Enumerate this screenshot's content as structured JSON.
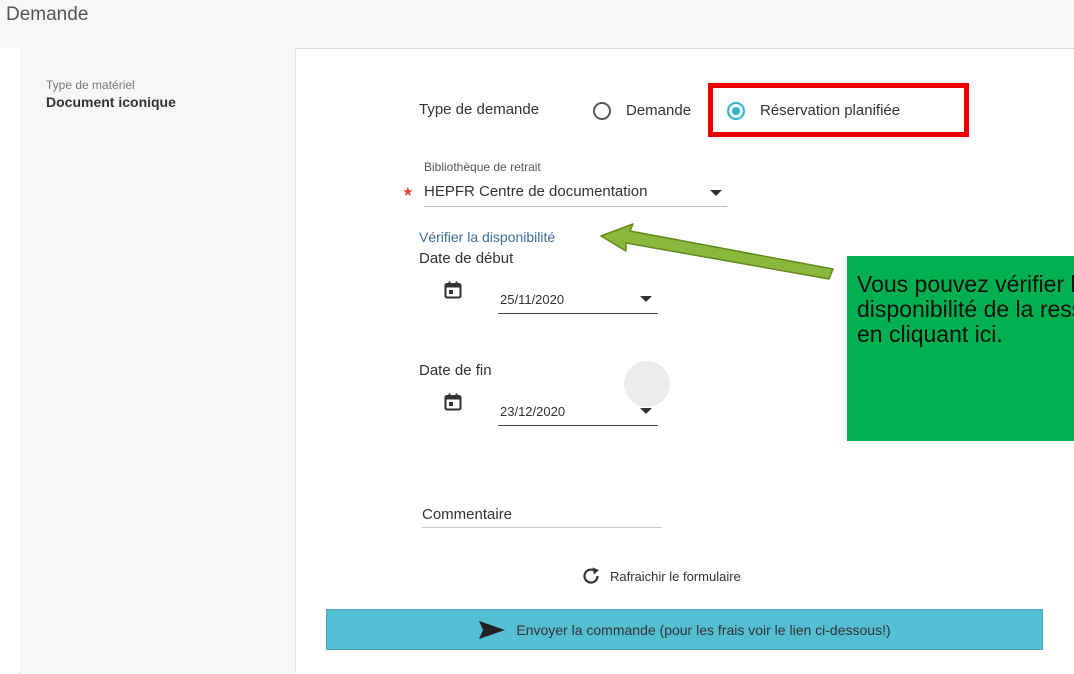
{
  "header": {
    "title": "Demande"
  },
  "sidebar": {
    "material_type_label": "Type de matériel",
    "material_type_value": "Document iconique"
  },
  "form": {
    "request_type_label": "Type de demande",
    "options": [
      {
        "label": "Demande",
        "selected": false
      },
      {
        "label": "Réservation planifiée",
        "selected": true
      }
    ],
    "library_label": "Bibliothèque de retrait",
    "required_marker": "★",
    "library_value": "HEPFR Centre de documentation",
    "check_availability": "Vérifier la disponibilité",
    "start_date_label": "Date de début",
    "start_date_value": "25/11/2020",
    "end_date_label": "Date de fin",
    "end_date_value": "23/12/2020",
    "comment_label": "Commentaire",
    "refresh_label": "Rafraichir le formulaire",
    "submit_label": "Envoyer la commande (pour les frais voir le lien ci-dessous!)"
  },
  "annotation": {
    "text": "Vous pouvez vérifier la disponibilité de la ressource en cliquant ici."
  },
  "colors": {
    "accent": "#2bb3c8",
    "submit_bg": "#54bed3",
    "callout_bg": "#00b050",
    "highlight": "#ee0000",
    "link": "#3a6d98",
    "arrow": "#8ab83c"
  },
  "icons": {
    "calendar": "calendar-icon",
    "dropdown": "chevron-down-icon",
    "refresh": "refresh-icon",
    "send": "send-icon"
  }
}
